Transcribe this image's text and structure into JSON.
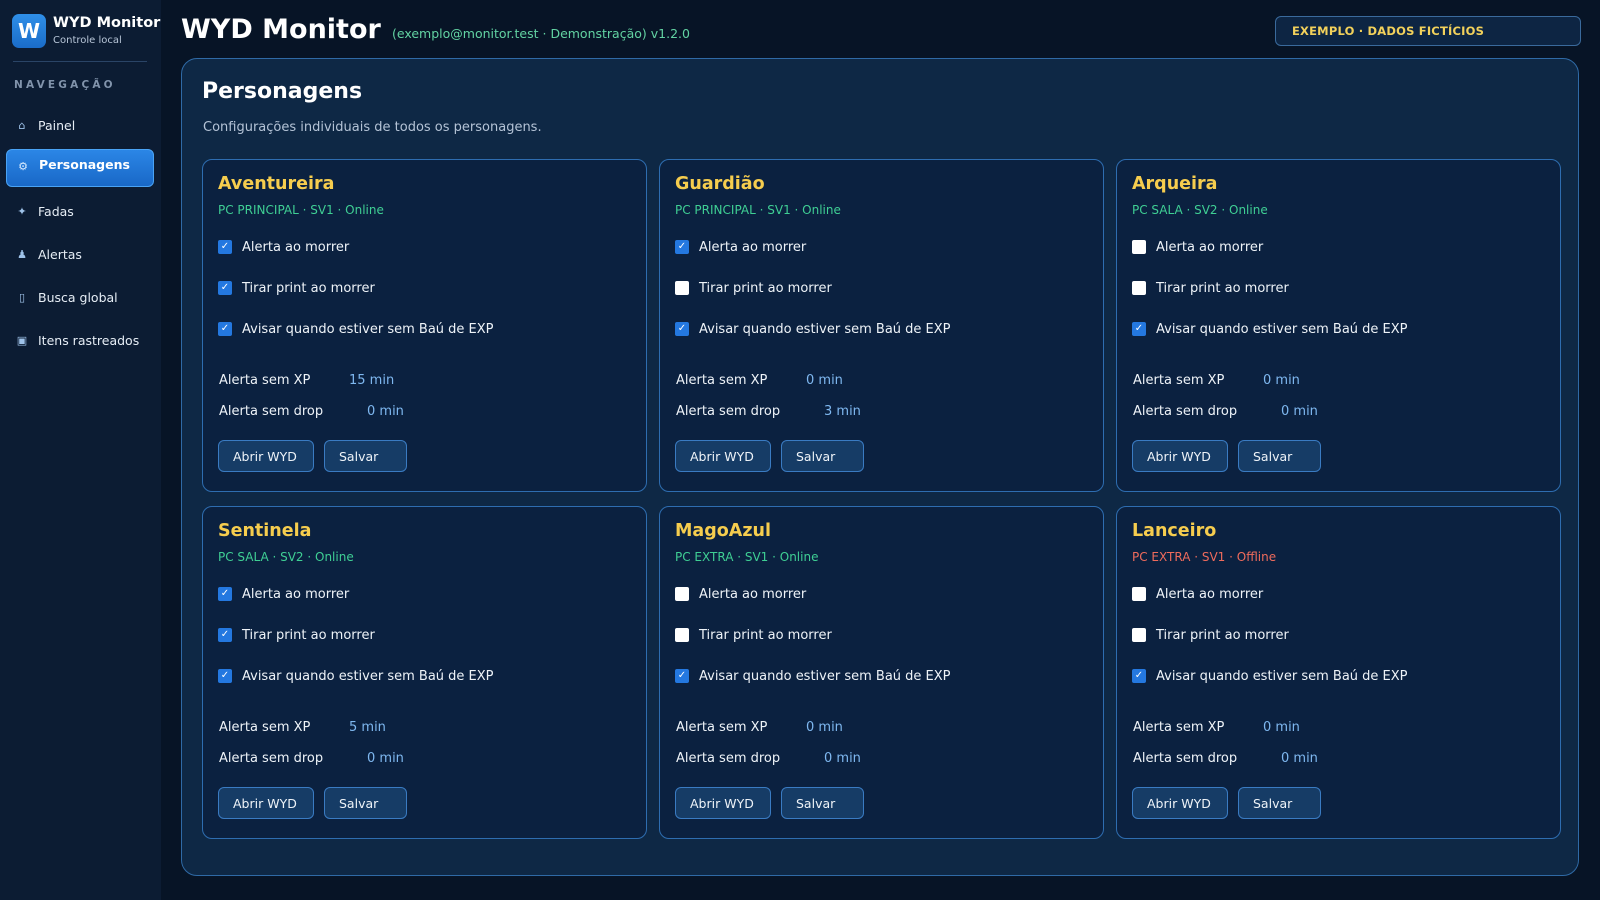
{
  "sidebar": {
    "logo_letter": "W",
    "brand_title": "WYD Monitor",
    "brand_subtitle": "Controle local",
    "nav_heading": "NAVEGAÇÃO",
    "items": [
      {
        "label": "Painel",
        "icon": "⌂",
        "icon_name": "home-icon",
        "active": false
      },
      {
        "label": "Personagens",
        "icon": "⚙",
        "icon_name": "gear-icon",
        "active": true
      },
      {
        "label": "Fadas",
        "icon": "✦",
        "icon_name": "sparkle-icon",
        "active": false
      },
      {
        "label": "Alertas",
        "icon": "♟",
        "icon_name": "pawn-icon",
        "active": false
      },
      {
        "label": "Busca global",
        "icon": "▯",
        "icon_name": "search-icon",
        "active": false
      },
      {
        "label": "Itens rastreados",
        "icon": "▣",
        "icon_name": "box-icon",
        "active": false
      }
    ]
  },
  "header": {
    "title": "WYD Monitor",
    "meta": "(exemplo@monitor.test · Demonstração)  v1.2.0",
    "badge": "EXEMPLO · DADOS FICTÍCIOS"
  },
  "main": {
    "title": "Personagens",
    "subtitle": "Configurações individuais de todos os personagens.",
    "option_labels": [
      "Alerta ao morrer",
      "Tirar print ao morrer",
      "Avisar quando estiver sem Baú de EXP"
    ],
    "xp_label": "Alerta sem XP",
    "drop_label": "Alerta sem drop",
    "open_button": "Abrir WYD",
    "save_button": "Salvar",
    "characters": [
      {
        "name": "Aventureira",
        "status": "PC PRINCIPAL · SV1 · Online",
        "online": true,
        "options": [
          true,
          true,
          true
        ],
        "xp": "15 min",
        "drop": "0 min"
      },
      {
        "name": "Guardião",
        "status": "PC PRINCIPAL · SV1 · Online",
        "online": true,
        "options": [
          true,
          false,
          true
        ],
        "xp": "0 min",
        "drop": "3 min"
      },
      {
        "name": "Arqueira",
        "status": "PC SALA · SV2 · Online",
        "online": true,
        "options": [
          false,
          false,
          true
        ],
        "xp": "0 min",
        "drop": "0 min"
      },
      {
        "name": "Sentinela",
        "status": "PC SALA · SV2 · Online",
        "online": true,
        "options": [
          true,
          true,
          true
        ],
        "xp": "5 min",
        "drop": "0 min"
      },
      {
        "name": "MagoAzul",
        "status": "PC EXTRA · SV1 · Online",
        "online": true,
        "options": [
          false,
          false,
          true
        ],
        "xp": "0 min",
        "drop": "0 min"
      },
      {
        "name": "Lanceiro",
        "status": "PC EXTRA · SV1 · Offline",
        "online": false,
        "options": [
          false,
          false,
          true
        ],
        "xp": "0 min",
        "drop": "0 min"
      }
    ]
  },
  "colors": {
    "accent": "#2478e0",
    "name": "#f6cd4e",
    "online": "#3fcf94",
    "offline": "#ef6b5c",
    "badge": "#f2d15b"
  }
}
